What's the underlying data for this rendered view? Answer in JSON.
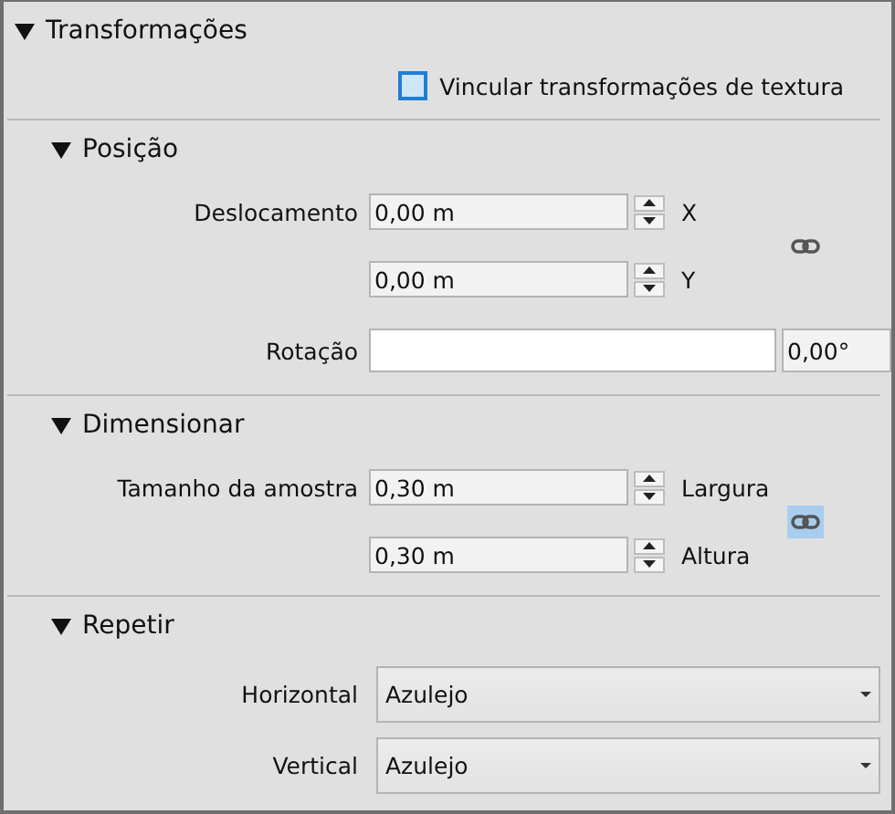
{
  "panel": {
    "title": "Transformações",
    "expanded": true,
    "link_texture": {
      "label": "Vincular transformações de textura",
      "checked": false
    }
  },
  "groups": [
    {
      "title": "Posição",
      "expanded": true,
      "kind": "spin",
      "link": {
        "selected": false
      },
      "rows": [
        {
          "label": "Deslocamento",
          "value": "0,00 m",
          "axis": "X"
        },
        {
          "value": "0,00 m",
          "axis": "Y"
        }
      ],
      "rotation": {
        "label": "Rotação",
        "value": "0,00°"
      }
    },
    {
      "title": "Dimensionar",
      "expanded": true,
      "kind": "spin",
      "link": {
        "selected": true
      },
      "rows": [
        {
          "label": "Tamanho da amostra",
          "value": "0,30 m",
          "axis": "Largura"
        },
        {
          "value": "0,30 m",
          "axis": "Altura"
        }
      ]
    },
    {
      "title": "Repetir",
      "expanded": true,
      "kind": "select",
      "rows": [
        {
          "label": "Horizontal",
          "value": "Azulejo"
        },
        {
          "label": "Vertical",
          "value": "Azulejo"
        }
      ]
    }
  ]
}
